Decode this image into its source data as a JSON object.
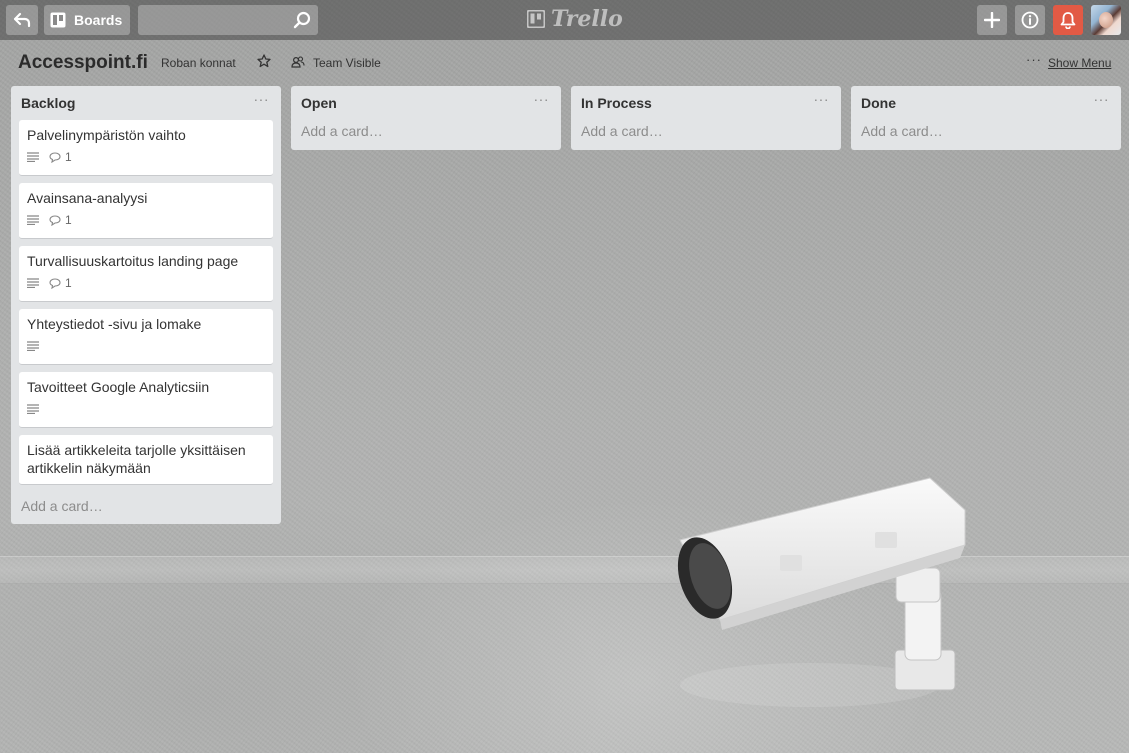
{
  "header": {
    "boards_label": "Boards",
    "search_value": "",
    "logo_text": "Trello"
  },
  "board": {
    "title": "Accesspoint.fi",
    "organization": "Roban konnat",
    "visibility": "Team Visible",
    "menu_dots": "···",
    "show_menu": "Show Menu"
  },
  "lists": [
    {
      "title": "Backlog",
      "menu": "···",
      "cards": [
        {
          "title": "Palvelinympäristön vaihto",
          "comments": "1"
        },
        {
          "title": "Avainsana-analyysi",
          "comments": "1"
        },
        {
          "title": "Turvallisuuskartoitus landing page",
          "comments": "1"
        },
        {
          "title": "Yhteystiedot -sivu ja lomake"
        },
        {
          "title": "Tavoitteet Google Analyticsiin"
        },
        {
          "title": "Lisää artikkeleita tarjolle yksittäisen artikkelin näkymään"
        }
      ],
      "add_card": "Add a card…"
    },
    {
      "title": "Open",
      "menu": "···",
      "add_card": "Add a card…"
    },
    {
      "title": "In Process",
      "menu": "···",
      "add_card": "Add a card…"
    },
    {
      "title": "Done",
      "menu": "···",
      "add_card": "Add a card…"
    }
  ],
  "colors": {
    "notification": "#e25a45",
    "list_bg": "#e2e4e6"
  }
}
